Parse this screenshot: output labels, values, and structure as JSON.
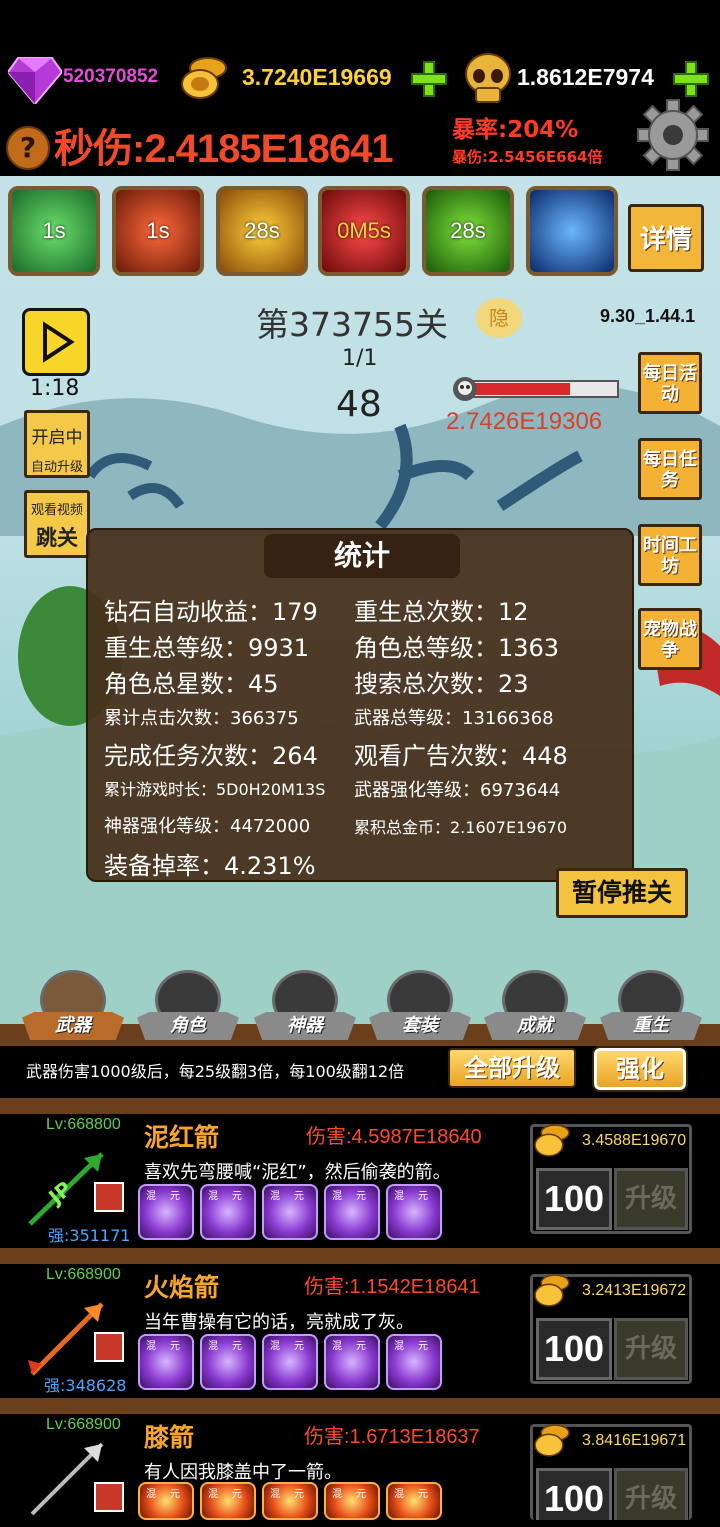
{
  "top": {
    "gems": "520370852",
    "gold": "3.7240E19669",
    "skulls": "1.8612E7974",
    "dps": "秒伤:2.4185E18641",
    "crit_rate": "暴率:204%",
    "crit_damage": "暴伤:2.5456E664倍",
    "help_symbol": "?"
  },
  "skills": [
    "1s",
    "1s",
    "28s",
    "0M5s",
    "28s",
    ""
  ],
  "detail_button": "详情",
  "stage": {
    "level": "第373755关",
    "hide_label": "隐",
    "version": "9.30_1.44.1",
    "wave": "1/1",
    "enemies_left": "48",
    "boss_hp": "2.7426E19306",
    "timer": "1:18"
  },
  "left_buttons": {
    "auto_upgrade_line1": "开启中",
    "auto_upgrade_line2": "自动升级",
    "watch_video": "观看视频",
    "skip_level": "跳关"
  },
  "side_buttons": [
    "每日活动",
    "每日任务",
    "时间工坊",
    "宠物战争"
  ],
  "stats": {
    "title": "统计",
    "items": [
      {
        "label": "钻石自动收益：179"
      },
      {
        "label": "重生总次数：12"
      },
      {
        "label": "重生总等级：9931"
      },
      {
        "label": "角色总等级：1363"
      },
      {
        "label": "角色总星数：45"
      },
      {
        "label": "搜索总次数：23"
      },
      {
        "label": "累计点击次数：366375"
      },
      {
        "label": "武器总等级：13166368"
      },
      {
        "label": "完成任务次数：264"
      },
      {
        "label": "观看广告次数：448"
      },
      {
        "label": "累计游戏时长：5D0H20M13S"
      },
      {
        "label": "武器强化等级：6973644"
      },
      {
        "label": "神器强化等级：4472000"
      },
      {
        "label": "累积总金币：2.1607E19670"
      },
      {
        "label": "装备掉率：4.231%"
      }
    ]
  },
  "pause_button": "暂停推关",
  "tabs": [
    "武器",
    "角色",
    "神器",
    "套装",
    "成就",
    "重生"
  ],
  "info_text": "武器伤害1000级后，每25级翻3倍，每100级翻12倍",
  "upgrade_all": "全部升级",
  "enhance": "强化",
  "orb_labels": [
    "混",
    "元"
  ],
  "weapons": [
    {
      "lv": "Lv:668800",
      "strong": "强:351171",
      "name": "泥红箭",
      "damage": "伤害:4.5987E18640",
      "desc": "喜欢先弯腰喊“泥红”，然后偷袭的箭。",
      "cost": "3.4588E19670",
      "qty": "100",
      "upgrade": "升级",
      "icon_text": "JP"
    },
    {
      "lv": "Lv:668900",
      "strong": "强:348628",
      "name": "火焰箭",
      "damage": "伤害:1.1542E18641",
      "desc": "当年曹操有它的话，亮就成了灰。",
      "cost": "3.2413E19672",
      "qty": "100",
      "upgrade": "升级",
      "icon_text": ""
    },
    {
      "lv": "Lv:668900",
      "strong": "",
      "name": "膝箭",
      "damage": "伤害:1.6713E18637",
      "desc": "有人因我膝盖中了一箭。",
      "cost": "3.8416E19671",
      "qty": "100",
      "upgrade": "升级",
      "icon_text": ""
    }
  ]
}
